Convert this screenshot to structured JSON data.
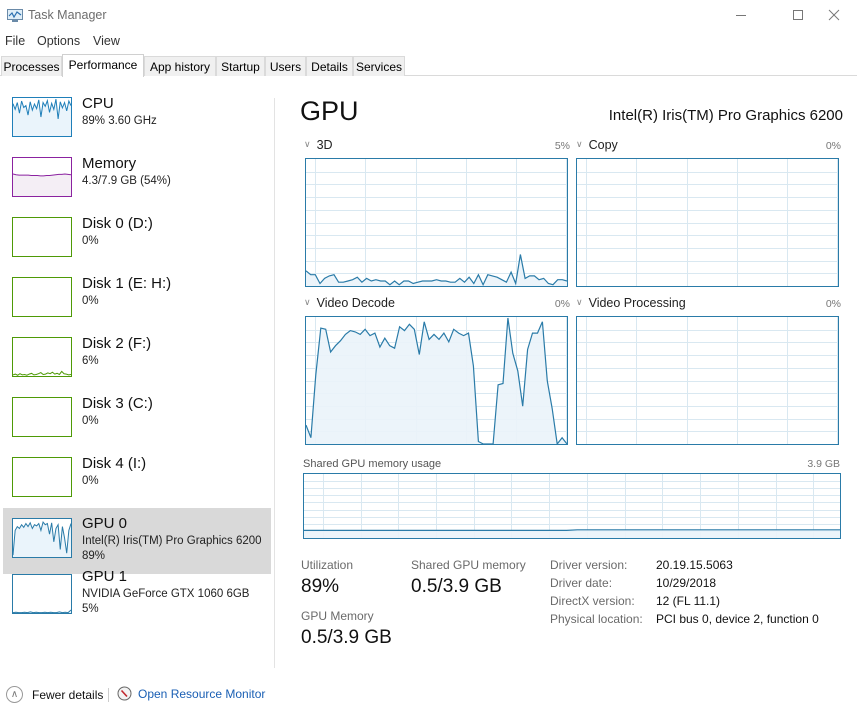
{
  "window": {
    "title": "Task Manager",
    "controls": [
      "minimize",
      "maximize",
      "close"
    ]
  },
  "menu": [
    "File",
    "Options",
    "View"
  ],
  "tabs": [
    {
      "label": "Processes",
      "active": false
    },
    {
      "label": "Performance",
      "active": true
    },
    {
      "label": "App history",
      "active": false
    },
    {
      "label": "Startup",
      "active": false
    },
    {
      "label": "Users",
      "active": false
    },
    {
      "label": "Details",
      "active": false
    },
    {
      "label": "Services",
      "active": false
    }
  ],
  "colors": {
    "cpu": "#1f7fb9",
    "memory": "#8b22a0",
    "disk": "#4e9a06",
    "gpu": "#2a7ba8",
    "selected_bg": "#d9d9d9",
    "link": "#1a5fb4"
  },
  "sidebar": {
    "items": [
      {
        "name": "CPU",
        "line1": "89% 3.60 GHz",
        "line2": "",
        "kind": "cpu",
        "selected": false,
        "history": [
          85,
          70,
          88,
          60,
          92,
          75,
          80,
          55,
          90,
          68,
          84,
          72,
          95,
          50,
          88,
          78,
          93,
          62,
          86,
          70,
          97,
          45,
          90,
          74,
          88,
          66,
          92,
          80
        ]
      },
      {
        "name": "Memory",
        "line1": "4.3/7.9 GB (54%)",
        "line2": "",
        "kind": "memory",
        "selected": false,
        "history": [
          58,
          56,
          55,
          55,
          55,
          55,
          54,
          54,
          54,
          53,
          53,
          54,
          54,
          55,
          56,
          57,
          57,
          58,
          57,
          56
        ]
      },
      {
        "name": "Disk 0 (D:)",
        "line1": "0%",
        "line2": "",
        "kind": "disk",
        "selected": false,
        "history": []
      },
      {
        "name": "Disk 1 (E: H:)",
        "line1": "0%",
        "line2": "",
        "kind": "disk",
        "selected": false,
        "history": []
      },
      {
        "name": "Disk 2 (F:)",
        "line1": "6%",
        "line2": "",
        "kind": "disk",
        "selected": false,
        "history": [
          3,
          5,
          2,
          6,
          3,
          4,
          2,
          5,
          7,
          3,
          4,
          6,
          9,
          4,
          5,
          8,
          6,
          10,
          5,
          7,
          4,
          12,
          6,
          5,
          3,
          4
        ]
      },
      {
        "name": "Disk 3 (C:)",
        "line1": "0%",
        "line2": "",
        "kind": "disk",
        "selected": false,
        "history": []
      },
      {
        "name": "Disk 4 (I:)",
        "line1": "0%",
        "line2": "",
        "kind": "disk",
        "selected": false,
        "history": []
      },
      {
        "name": "GPU 0",
        "line1": "Intel(R) Iris(TM) Pro Graphics 6200",
        "line2": "89%",
        "kind": "gpu",
        "selected": true,
        "history": [
          5,
          70,
          80,
          75,
          85,
          78,
          88,
          80,
          90,
          75,
          85,
          82,
          88,
          70,
          92,
          85,
          88,
          60,
          90,
          40,
          75,
          85,
          20,
          80,
          50,
          10,
          70,
          88
        ]
      },
      {
        "name": "GPU 1",
        "line1": "NVIDIA GeForce GTX 1060 6GB",
        "line2": "5%",
        "kind": "gpu",
        "selected": false,
        "history": [
          1,
          2,
          1,
          1,
          2,
          1,
          3,
          1,
          2,
          1,
          1,
          2,
          1,
          2,
          1,
          1,
          3,
          1,
          2,
          1,
          8
        ]
      }
    ]
  },
  "main": {
    "title": "GPU",
    "model": "Intel(R) Iris(TM) Pro Graphics 6200",
    "engines": [
      {
        "label": "3D",
        "percent": "5%",
        "history": [
          12,
          9,
          9,
          2,
          6,
          8,
          9,
          3,
          3,
          4,
          5,
          7,
          3,
          6,
          4,
          5,
          4,
          4,
          1,
          4,
          1,
          4,
          4,
          2,
          3,
          4,
          4,
          4,
          5,
          4,
          4,
          3,
          3,
          6,
          3,
          7,
          2,
          9,
          1,
          9,
          8,
          7,
          5,
          3,
          11,
          2,
          25,
          6,
          8,
          8,
          5,
          6,
          2,
          1,
          5,
          5,
          4
        ]
      },
      {
        "label": "Copy",
        "percent": "0%",
        "history": []
      },
      {
        "label": "Video Decode",
        "percent": "0%",
        "history": [
          15,
          5,
          55,
          92,
          91,
          73,
          78,
          82,
          87,
          90,
          89,
          87,
          91,
          86,
          88,
          77,
          84,
          78,
          76,
          93,
          90,
          95,
          91,
          71,
          97,
          83,
          87,
          83,
          88,
          81,
          91,
          88,
          86,
          88,
          62,
          2,
          0,
          0,
          0,
          47,
          48,
          100,
          72,
          58,
          30,
          75,
          88,
          88,
          97,
          50,
          28,
          0,
          5,
          0
        ]
      },
      {
        "label": "Video Processing",
        "percent": "0%",
        "history": []
      }
    ],
    "shared_memory": {
      "label": "Shared GPU memory usage",
      "max": "3.9 GB",
      "history": [
        12,
        12,
        12,
        12,
        12,
        12,
        12,
        12,
        12,
        12,
        12,
        12,
        12,
        12,
        12,
        12,
        12,
        12,
        12,
        12,
        12,
        12,
        12,
        12,
        12,
        12,
        13,
        13,
        13,
        13,
        13,
        13,
        13,
        13,
        13,
        13,
        13,
        13,
        13,
        13,
        13,
        13,
        13,
        13,
        13,
        13,
        13,
        13,
        13,
        13,
        13,
        13
      ]
    },
    "stats": {
      "utilization_label": "Utilization",
      "utilization_value": "89%",
      "shared_label": "Shared GPU memory",
      "shared_value": "0.5/3.9 GB",
      "gpu_memory_label": "GPU Memory",
      "gpu_memory_value": "0.5/3.9 GB"
    },
    "details": [
      {
        "key": "Driver version:",
        "value": "20.19.15.5063"
      },
      {
        "key": "Driver date:",
        "value": "10/29/2018"
      },
      {
        "key": "DirectX version:",
        "value": "12 (FL 11.1)"
      },
      {
        "key": "Physical location:",
        "value": "PCI bus 0, device 2, function 0"
      }
    ]
  },
  "footer": {
    "fewer_details": "Fewer details",
    "open_resource_monitor": "Open Resource Monitor"
  }
}
